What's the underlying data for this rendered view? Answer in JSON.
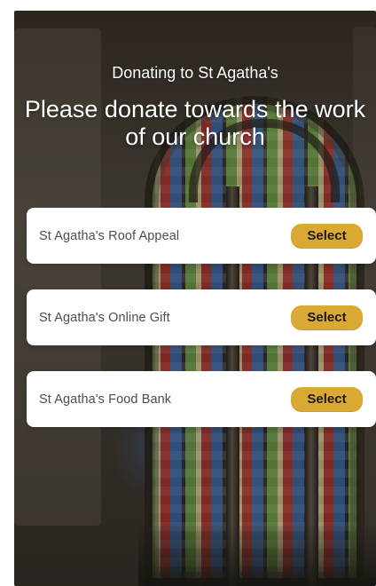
{
  "header": {
    "subtitle": "Donating to St Agatha's",
    "title": "Please donate towards the work of our church"
  },
  "options": [
    {
      "label": "St Agatha's Roof Appeal",
      "button": "Select"
    },
    {
      "label": "St Agatha's Online Gift",
      "button": "Select"
    },
    {
      "label": "St Agatha's Food Bank",
      "button": "Select"
    }
  ],
  "colors": {
    "select_button": "#d9a933",
    "card_background": "#ffffff",
    "text_on_image": "#ffffff"
  }
}
